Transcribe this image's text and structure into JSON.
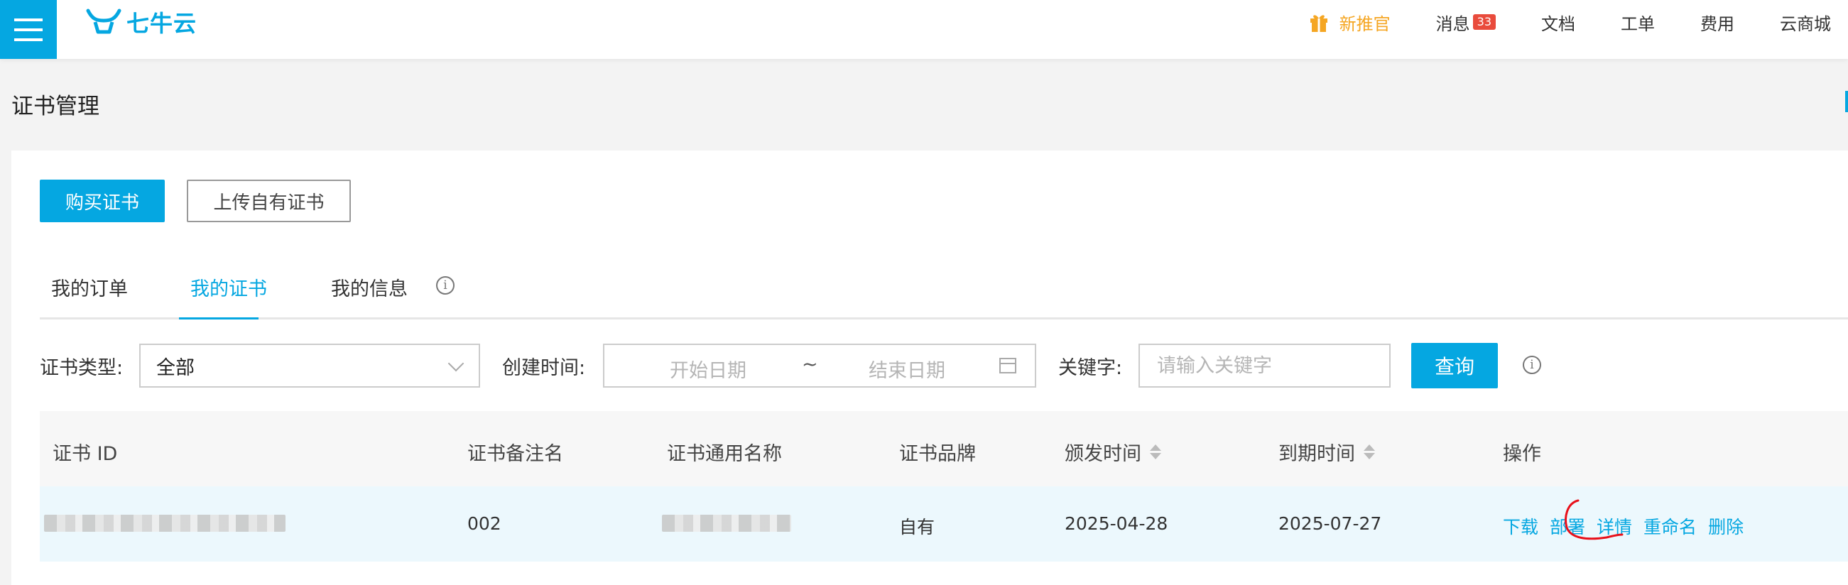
{
  "header": {
    "logo_text": "七牛云",
    "promo_label": "新推官",
    "nav": [
      {
        "label": "消息",
        "badge": "33"
      },
      {
        "label": "文档"
      },
      {
        "label": "工单"
      },
      {
        "label": "费用"
      },
      {
        "label": "云商城"
      }
    ],
    "accent_color": "#05a7e1",
    "promo_color": "#f5a623"
  },
  "page": {
    "title": "证书管理"
  },
  "actions": {
    "buy_label": "购买证书",
    "upload_label": "上传自有证书"
  },
  "tabs": [
    {
      "label": "我的订单",
      "active": false
    },
    {
      "label": "我的证书",
      "active": true
    },
    {
      "label": "我的信息",
      "active": false
    }
  ],
  "filters": {
    "type_label": "证书类型:",
    "type_value": "全部",
    "created_label": "创建时间:",
    "start_placeholder": "开始日期",
    "range_separator": "~",
    "end_placeholder": "结束日期",
    "keyword_label": "关键字:",
    "keyword_placeholder": "请输入关键字",
    "query_label": "查询"
  },
  "table": {
    "columns": [
      "证书 ID",
      "证书备注名",
      "证书通用名称",
      "证书品牌",
      "颁发时间",
      "到期时间",
      "操作"
    ],
    "rows": [
      {
        "remark": "002",
        "brand": "自有",
        "issued": "2025-04-28",
        "expires": "2025-07-27",
        "ops": [
          "下载",
          "部署",
          "详情",
          "重命名",
          "删除"
        ]
      }
    ]
  }
}
